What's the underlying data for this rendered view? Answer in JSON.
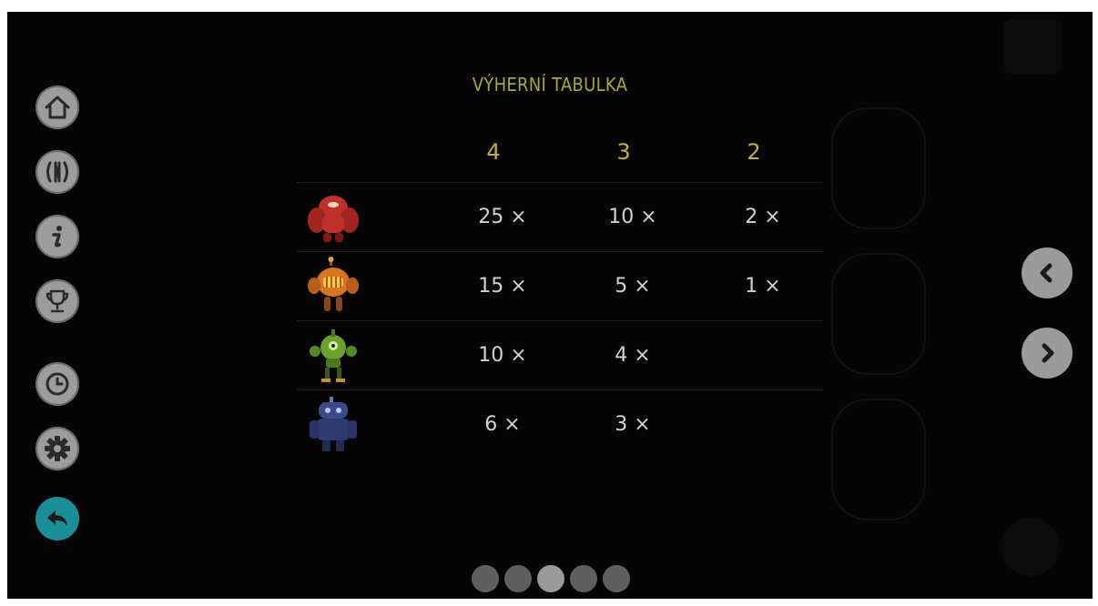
{
  "paytable": {
    "title": "VÝHERNÍ TABULKA",
    "columns": [
      "4",
      "3",
      "2"
    ],
    "rows": [
      {
        "symbol": "red-robot",
        "color": "#c0302a",
        "values": [
          "25 ×",
          "10 ×",
          "2 ×"
        ]
      },
      {
        "symbol": "orange-robot",
        "color": "#d9731f",
        "values": [
          "15 ×",
          "5 ×",
          "1 ×"
        ]
      },
      {
        "symbol": "green-robot",
        "color": "#6aa22a",
        "values": [
          "10 ×",
          "4 ×",
          ""
        ]
      },
      {
        "symbol": "blue-robot",
        "color": "#3d4a8a",
        "values": [
          "6 ×",
          "3 ×",
          ""
        ]
      }
    ]
  },
  "sidebar": {
    "items": [
      {
        "icon": "home-icon"
      },
      {
        "icon": "paylines-icon"
      },
      {
        "icon": "info-icon"
      },
      {
        "icon": "trophy-icon"
      },
      {
        "icon": "history-icon"
      },
      {
        "icon": "settings-icon"
      },
      {
        "icon": "back-arrow-icon",
        "color": "#1a8f98"
      }
    ]
  },
  "navigation": {
    "prev_icon": "chevron-left-icon",
    "next_icon": "chevron-right-icon"
  },
  "pagination": {
    "total": 5,
    "active_index": 2
  },
  "colors": {
    "accent": "#b8b63a",
    "text": "#d2d2d2",
    "background": "#050505",
    "back_button": "#1a8f98"
  }
}
